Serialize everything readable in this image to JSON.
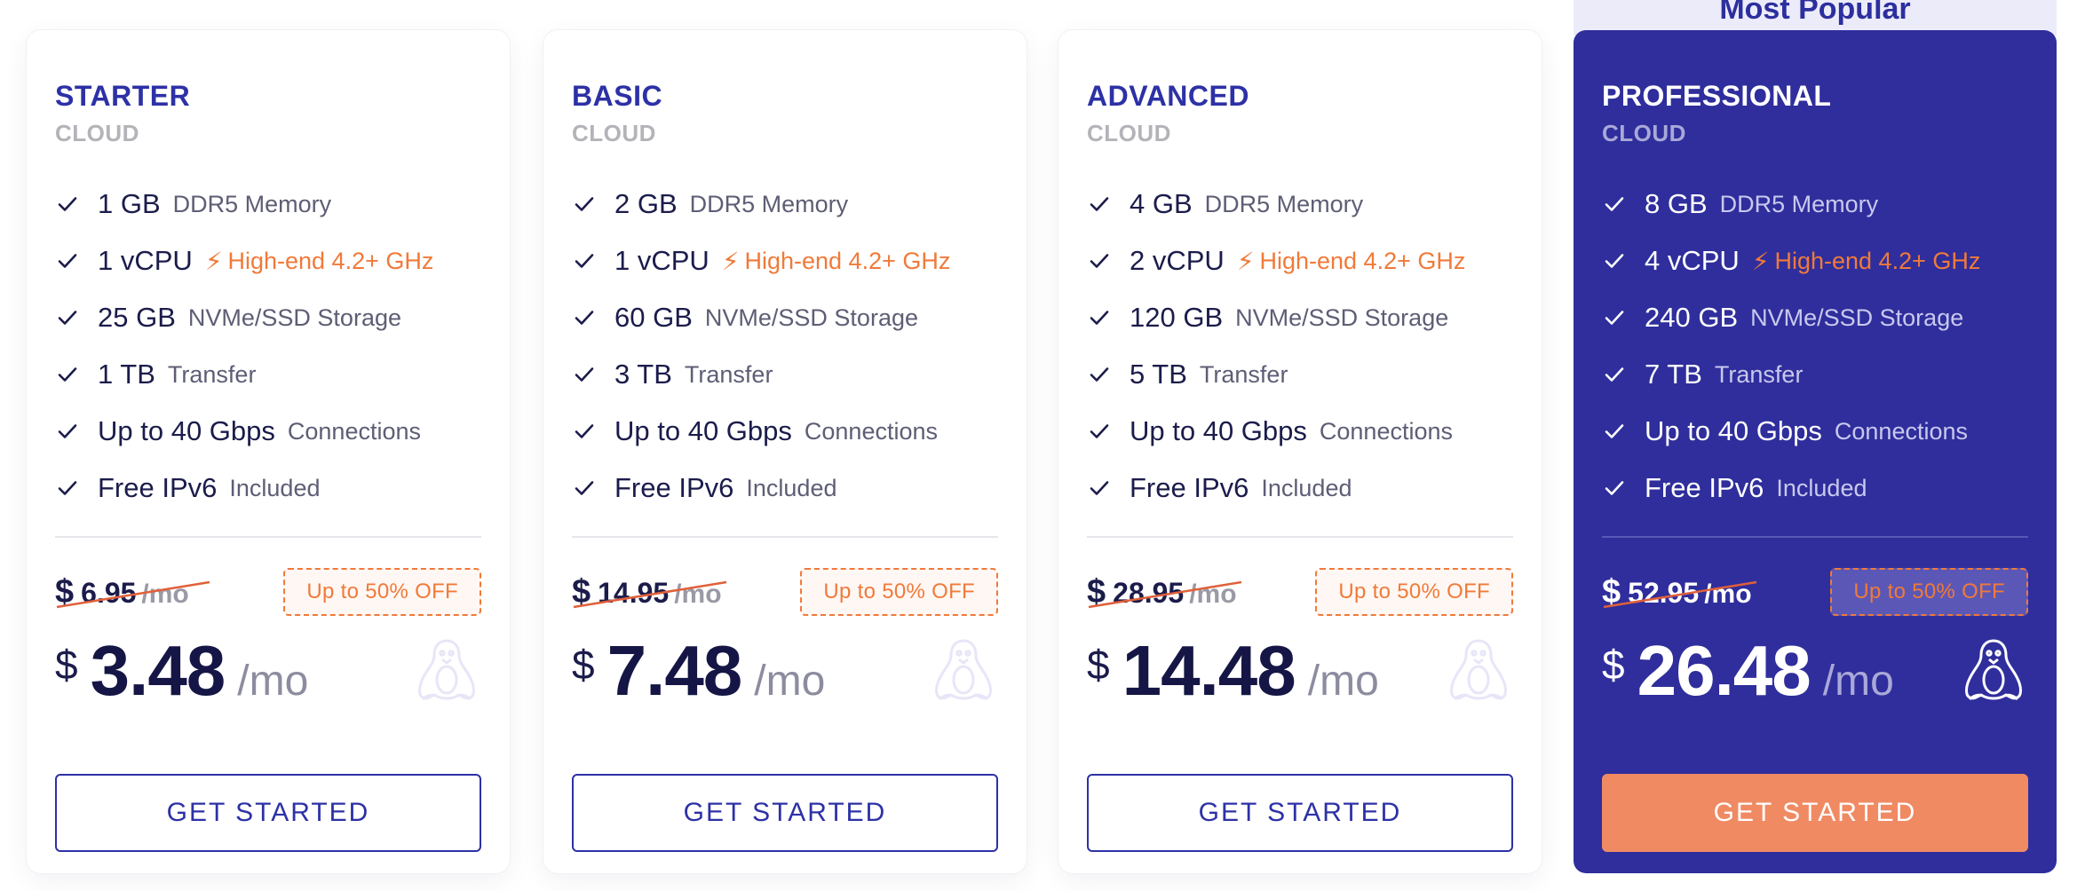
{
  "popular_label": "Most Popular",
  "plans": [
    {
      "name": "STARTER",
      "sub": "CLOUD",
      "features": [
        {
          "main": "1 GB",
          "sub": "DDR5 Memory"
        },
        {
          "main": "1 vCPU",
          "sub": "High-end 4.2+ GHz"
        },
        {
          "main": "25 GB",
          "sub": "NVMe/SSD Storage"
        },
        {
          "main": "1 TB",
          "sub": "Transfer"
        },
        {
          "main": "Up to 40 Gbps",
          "sub": "Connections"
        },
        {
          "main": "Free IPv6",
          "sub": "Included"
        }
      ],
      "old_currency": "$",
      "old_price": "6.95",
      "old_period": "/mo",
      "badge": "Up to 50% OFF",
      "currency": "$",
      "price": "3.48",
      "period": "/mo",
      "cta": "GET STARTED"
    },
    {
      "name": "BASIC",
      "sub": "CLOUD",
      "features": [
        {
          "main": "2 GB",
          "sub": "DDR5 Memory"
        },
        {
          "main": "1 vCPU",
          "sub": "High-end 4.2+ GHz"
        },
        {
          "main": "60 GB",
          "sub": "NVMe/SSD Storage"
        },
        {
          "main": "3 TB",
          "sub": "Transfer"
        },
        {
          "main": "Up to 40 Gbps",
          "sub": "Connections"
        },
        {
          "main": "Free IPv6",
          "sub": "Included"
        }
      ],
      "old_currency": "$",
      "old_price": "14.95",
      "old_period": "/mo",
      "badge": "Up to 50% OFF",
      "currency": "$",
      "price": "7.48",
      "period": "/mo",
      "cta": "GET STARTED"
    },
    {
      "name": "ADVANCED",
      "sub": "CLOUD",
      "features": [
        {
          "main": "4 GB",
          "sub": "DDR5 Memory"
        },
        {
          "main": "2 vCPU",
          "sub": "High-end 4.2+ GHz"
        },
        {
          "main": "120 GB",
          "sub": "NVMe/SSD Storage"
        },
        {
          "main": "5 TB",
          "sub": "Transfer"
        },
        {
          "main": "Up to 40 Gbps",
          "sub": "Connections"
        },
        {
          "main": "Free IPv6",
          "sub": "Included"
        }
      ],
      "old_currency": "$",
      "old_price": "28.95",
      "old_period": "/mo",
      "badge": "Up to 50% OFF",
      "currency": "$",
      "price": "14.48",
      "period": "/mo",
      "cta": "GET STARTED"
    },
    {
      "name": "PROFESSIONAL",
      "sub": "CLOUD",
      "features": [
        {
          "main": "8 GB",
          "sub": "DDR5 Memory"
        },
        {
          "main": "4 vCPU",
          "sub": "High-end 4.2+ GHz"
        },
        {
          "main": "240 GB",
          "sub": "NVMe/SSD Storage"
        },
        {
          "main": "7 TB",
          "sub": "Transfer"
        },
        {
          "main": "Up to 40 Gbps",
          "sub": "Connections"
        },
        {
          "main": "Free IPv6",
          "sub": "Included"
        }
      ],
      "old_currency": "$",
      "old_price": "52.95",
      "old_period": "/mo",
      "badge": "Up to 50% OFF",
      "currency": "$",
      "price": "26.48",
      "period": "/mo",
      "cta": "GET STARTED"
    }
  ],
  "colors": {
    "brand": "#2d31a6",
    "featured_bg": "#2f2e9c",
    "accent": "#f07a3a",
    "cta_featured": "#f08a63"
  },
  "icons": {
    "check": "check-icon",
    "bolt": "lightning-bolt-icon",
    "os": "linux-penguin-icon"
  }
}
